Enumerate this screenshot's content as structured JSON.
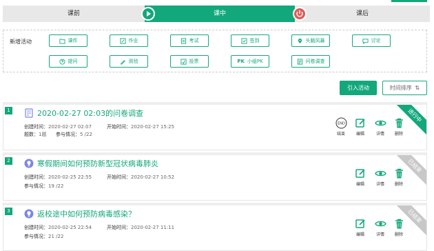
{
  "stages": {
    "before": "课前",
    "during": "课中",
    "after": "课后"
  },
  "activities": {
    "title": "新增活动",
    "buttons": [
      {
        "label": "课件",
        "icon": "folder-icon"
      },
      {
        "label": "作业",
        "icon": "edit-icon"
      },
      {
        "label": "考试",
        "icon": "exam-icon"
      },
      {
        "label": "签到",
        "icon": "checkin-icon"
      },
      {
        "label": "头脑风暴",
        "icon": "location-icon"
      },
      {
        "label": "讨论",
        "icon": "chat-icon"
      },
      {
        "label": "提问",
        "icon": "question-icon"
      },
      {
        "label": "测验",
        "icon": "quiz-icon"
      },
      {
        "label": "投票",
        "icon": "vote-icon"
      },
      {
        "label": "小组PK",
        "icon": "pk-icon"
      },
      {
        "label": "问卷调查",
        "icon": "survey-icon"
      }
    ]
  },
  "toolbar": {
    "import_label": "引入活动",
    "sort_label": "时间排序"
  },
  "labels": {
    "created": "创建时间：",
    "started": "开始时间：",
    "questions": "题数：",
    "participation": "参与情况：",
    "end": "结束",
    "edit": "编辑",
    "detail": "详情",
    "delete": "删除",
    "end_badge": "END"
  },
  "cards": [
    {
      "num": "1",
      "title": "2020-02-27 02:03的问卷调查",
      "created": "2020-02-27 02:07",
      "started": "2020-02-27 15:25",
      "questions": "1题",
      "participation": "5 /22",
      "status": "进行中"
    },
    {
      "num": "2",
      "title": "寒假期间如何预防新型冠状病毒肺炎",
      "created": "2020-02-25 22:55",
      "started": "2020-02-27 10:52",
      "participation": "19 /22",
      "status": "已结束"
    },
    {
      "num": "3",
      "title": "返校途中如何预防病毒感染？",
      "created": "2020-02-25 22:54",
      "started": "2020-02-27 11:11",
      "participation": "21 /22",
      "status": "已结束"
    }
  ],
  "colors": {
    "accent": "#12a87b",
    "ended": "#c8c8c8",
    "stop_icon": "#e05a5a",
    "bulb_icon": "#7b86e8"
  }
}
